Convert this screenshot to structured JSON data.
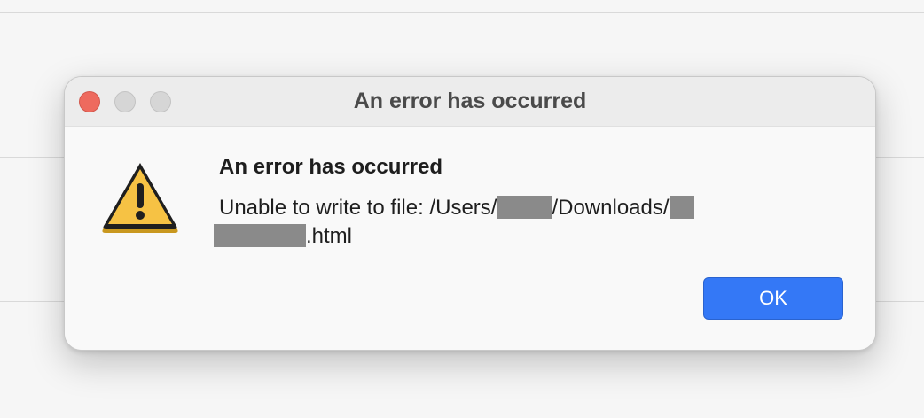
{
  "window": {
    "title": "An error has occurred",
    "controls": [
      "close",
      "minimize",
      "zoom"
    ]
  },
  "alert": {
    "icon": "warning-icon",
    "heading": "An error has occurred",
    "message_prefix": "Unable to write to file: /Users/",
    "message_middle": "/Downloads/",
    "message_suffix": ".html",
    "ok_label": "OK"
  },
  "colors": {
    "accent": "#3478f6",
    "close": "#ee6a5e",
    "warning_fill": "#f6c244",
    "redaction": "#8a8a8a"
  }
}
